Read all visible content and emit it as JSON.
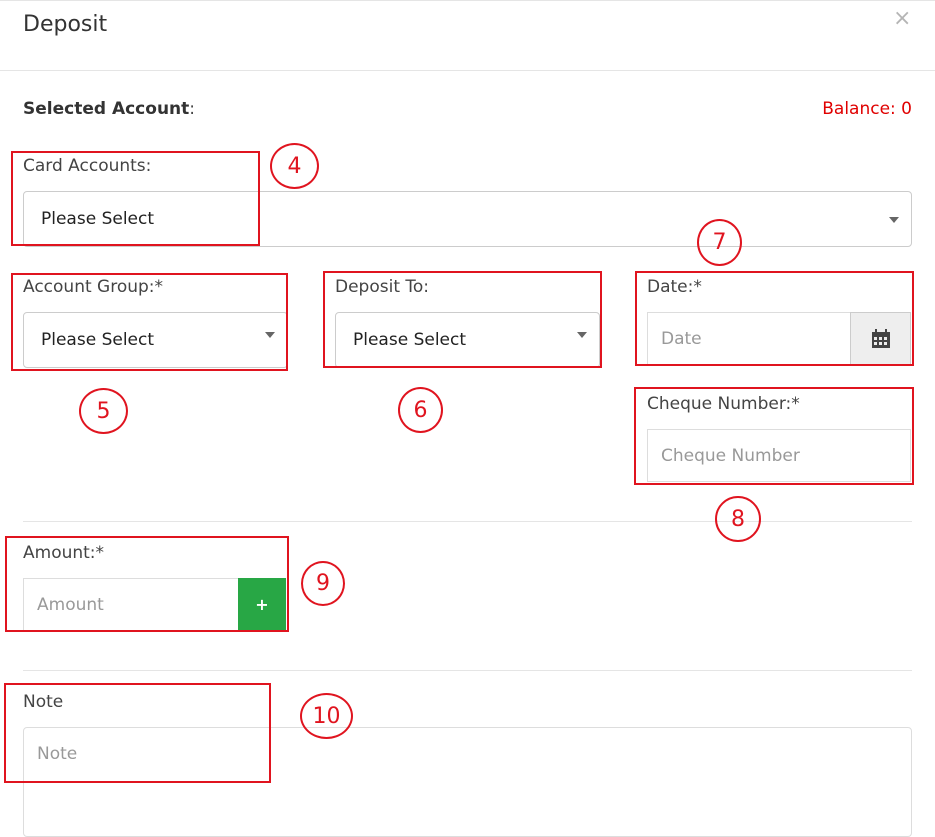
{
  "header": {
    "title": "Deposit",
    "close_symbol": "×"
  },
  "selected_account": {
    "label": "Selected Account",
    "colon": ":"
  },
  "balance": {
    "text": "Balance: 0"
  },
  "card_accounts": {
    "label": "Card Accounts:",
    "value": "Please Select"
  },
  "account_group": {
    "label": "Account Group:*",
    "value": "Please Select"
  },
  "deposit_to": {
    "label": "Deposit To:",
    "value": "Please Select"
  },
  "date": {
    "label": "Date:*",
    "placeholder": "Date",
    "icon": "calendar-icon"
  },
  "cheque": {
    "label": "Cheque Number:*",
    "placeholder": "Cheque Number"
  },
  "amount": {
    "label": "Amount:*",
    "placeholder": "Amount",
    "add_label": "+"
  },
  "note": {
    "label": "Note",
    "placeholder": "Note"
  },
  "annotations": [
    "4",
    "5",
    "6",
    "7",
    "8",
    "9",
    "10"
  ],
  "colors": {
    "annotation": "#e0141f",
    "balance": "#e00000",
    "add_button": "#28a745"
  }
}
